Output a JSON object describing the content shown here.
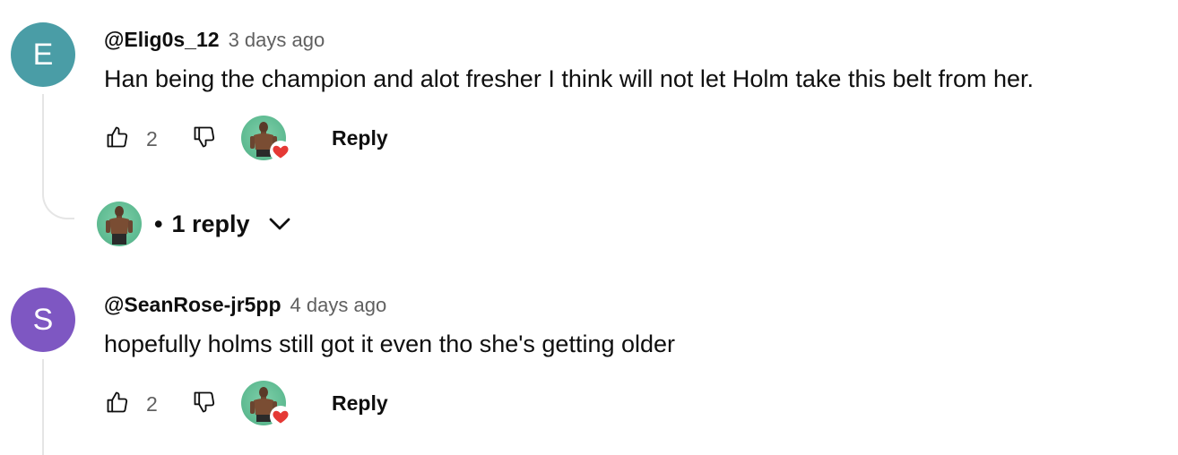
{
  "comments": [
    {
      "avatar_letter": "E",
      "avatar_color": "#4a9da6",
      "handle": "@Elig0s_12",
      "time": "3 days ago",
      "text": "Han being the champion and alot fresher I think will not let Holm take this belt from her.",
      "likes": "2",
      "creator_heart": true,
      "reply_label": "Reply",
      "replies_label": "1 reply"
    },
    {
      "avatar_letter": "S",
      "avatar_color": "#7e57c2",
      "handle": "@SeanRose-jr5pp",
      "time": "4 days ago",
      "text": "hopefully holms still got it even tho she's getting older",
      "likes": "2",
      "creator_heart": true,
      "reply_label": "Reply"
    }
  ],
  "separator": "•",
  "icons": {
    "like": "thumb-up-icon",
    "dislike": "thumb-down-icon",
    "heart": "heart-icon",
    "expand": "chevron-down-icon"
  },
  "colors": {
    "heart": "#e53935",
    "secondary_text": "#606060"
  }
}
